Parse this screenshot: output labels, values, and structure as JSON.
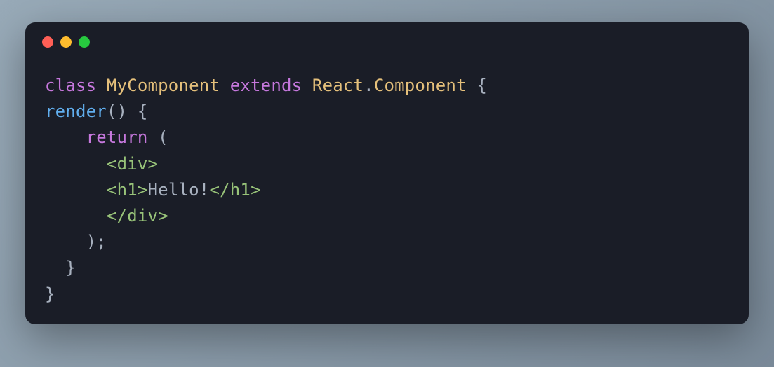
{
  "code": {
    "line1": {
      "kw_class": "class",
      "sp1": " ",
      "className": "MyComponent",
      "sp2": " ",
      "kw_extends": "extends",
      "sp3": " ",
      "reactObj": "React",
      "dot": ".",
      "component": "Component",
      "sp4": " ",
      "brace": "{"
    },
    "line2": {
      "fn": "render",
      "parens": "()",
      "sp": " ",
      "brace": "{"
    },
    "line3": {
      "indent": "    ",
      "kw_return": "return",
      "sp": " ",
      "paren": "("
    },
    "line4": {
      "indent": "      ",
      "open": "<",
      "tag": "div",
      "close": ">"
    },
    "line5": {
      "indent": "      ",
      "open1": "<",
      "tag1": "h1",
      "close1": ">",
      "text": "Hello!",
      "open2": "</",
      "tag2": "h1",
      "close2": ">"
    },
    "line6": {
      "indent": "      ",
      "open": "</",
      "tag": "div",
      "close": ">"
    },
    "line7": {
      "indent": "    ",
      "text": ");"
    },
    "line8": {
      "indent": "  ",
      "text": "}"
    },
    "line9": {
      "text": "}"
    }
  }
}
